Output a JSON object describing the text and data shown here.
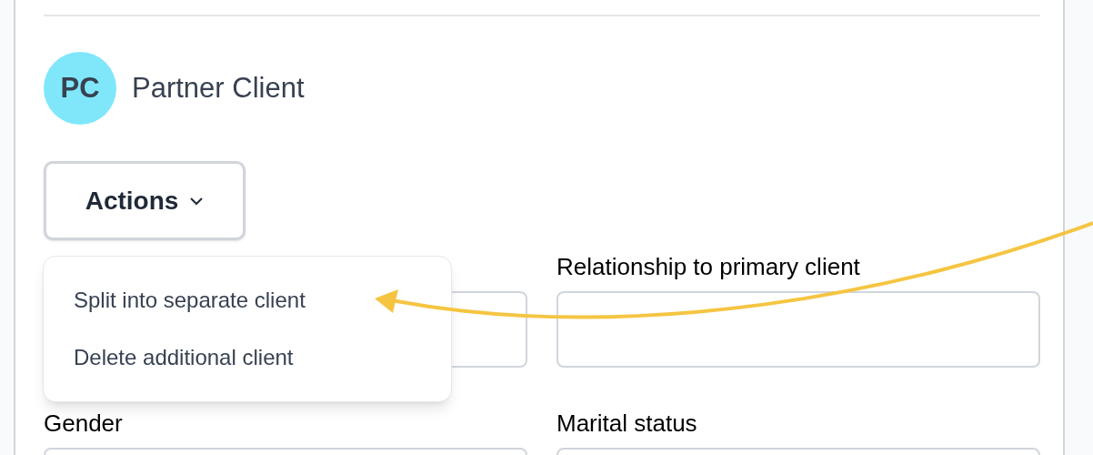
{
  "client": {
    "initials": "PC",
    "name": "Partner Client"
  },
  "actions": {
    "label": "Actions",
    "expanded": true,
    "menu": [
      {
        "label": "Split into separate client"
      },
      {
        "label": "Delete additional client"
      }
    ]
  },
  "form_rows": [
    {
      "right_label": "Relationship to primary client"
    },
    {
      "left_label": "Gender",
      "right_label": "Marital status"
    }
  ]
}
